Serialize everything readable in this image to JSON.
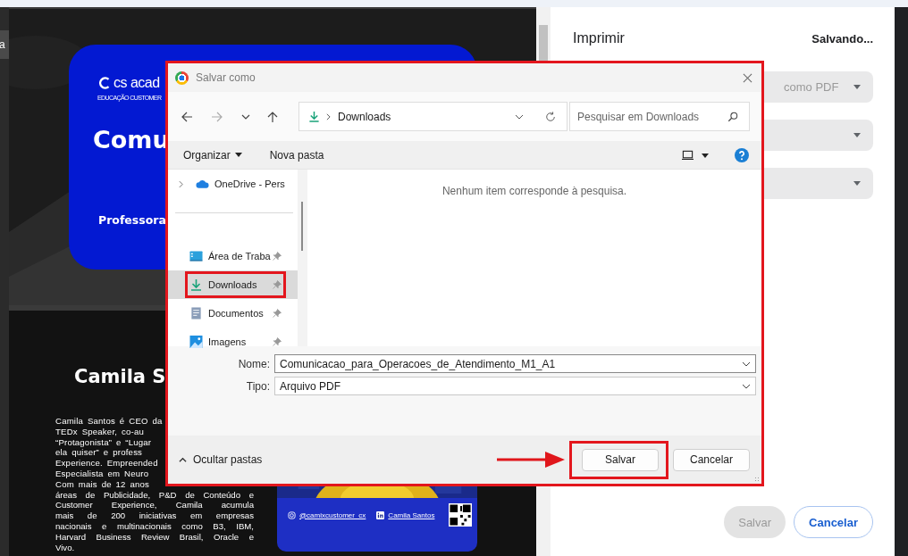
{
  "preview": {
    "edge_text": "a",
    "cover": {
      "logo_text": "cs acad",
      "logo_tagline": "EDUCAÇÃO CUSTOMER",
      "title": "Comu",
      "subtitle": "Professora"
    },
    "bio": {
      "name": "Camila S",
      "lines": [
        {
          "text": "Camila Santos é CEO da",
          "cut": true
        },
        {
          "text": "TEDx Speaker, co-au",
          "cut": true
        },
        {
          "text": "“Protagonista” e “Lugar",
          "cut": true
        },
        {
          "text": "ela quiser” e profess",
          "cut": true
        },
        {
          "text": "Experience. Empreended",
          "cut": true
        },
        {
          "text": "Especialista em Neuro",
          "cut": true
        },
        {
          "text": "Com mais de 12 anos",
          "cut": true
        },
        {
          "text": "áreas de Publicidade, P&D de Conteúdo e",
          "cut": false
        },
        {
          "text": "Customer Experience, Camila acumula",
          "cut": false
        },
        {
          "text": "mais de 200 iniciativas em empresas",
          "cut": false
        },
        {
          "text": "nacionais e multinacionais como B3, IBM,",
          "cut": false
        },
        {
          "text": "Harvard Business Review Brasil, Oracle e",
          "cut": false
        },
        {
          "text": "Vivo.",
          "cut": false
        }
      ],
      "social": [
        {
          "kind": "instagram",
          "handle": "@camixcustomer_cx"
        },
        {
          "kind": "linkedin",
          "handle": "Camila Santos"
        }
      ]
    }
  },
  "print_panel": {
    "title": "Imprimir",
    "status": "Salvando...",
    "settings": [
      {
        "kind": "dropdown",
        "value": "como PDF"
      },
      {
        "kind": "dropdown"
      },
      {
        "kind": "dropdown"
      }
    ],
    "buttons": [
      {
        "label": "Salvar",
        "kind": "primary",
        "disabled": true
      },
      {
        "label": "Cancelar",
        "kind": "secondary",
        "disabled": false
      }
    ]
  },
  "dialog": {
    "title": "Salvar como",
    "nav": {
      "forward_disabled": true
    },
    "address": "Downloads",
    "search": {
      "placeholder": "Pesquisar em Downloads"
    },
    "toolbar": [
      {
        "label": "Organizar",
        "kind": "menu"
      },
      {
        "label": "Nova pasta",
        "kind": "button"
      }
    ],
    "nav_pane": {
      "top": [
        {
          "label": "OneDrive - Pers",
          "kind": "cloud",
          "selected": false
        }
      ],
      "quick_access": [
        {
          "label": "Área de Traba",
          "kind": "desktop",
          "selected": false,
          "pinned": true,
          "highlighted": false
        },
        {
          "label": "Downloads",
          "kind": "download",
          "selected": true,
          "pinned": true,
          "highlighted": true
        },
        {
          "label": "Documentos",
          "kind": "document",
          "selected": false,
          "pinned": true,
          "highlighted": false
        },
        {
          "label": "Imagens",
          "kind": "pictures",
          "selected": false,
          "pinned": true,
          "highlighted": false
        }
      ]
    },
    "empty_message": "Nenhum item corresponde à pesquisa.",
    "fields": [
      {
        "label": "Nome:",
        "value": "Comunicacao_para_Operacoes_de_Atendimento_M1_A1"
      },
      {
        "label": "Tipo:",
        "value": "Arquivo PDF"
      }
    ],
    "folders_toggle": "Ocultar pastas",
    "buttons": [
      {
        "label": "Salvar",
        "highlighted": true
      },
      {
        "label": "Cancelar",
        "highlighted": false
      }
    ]
  }
}
